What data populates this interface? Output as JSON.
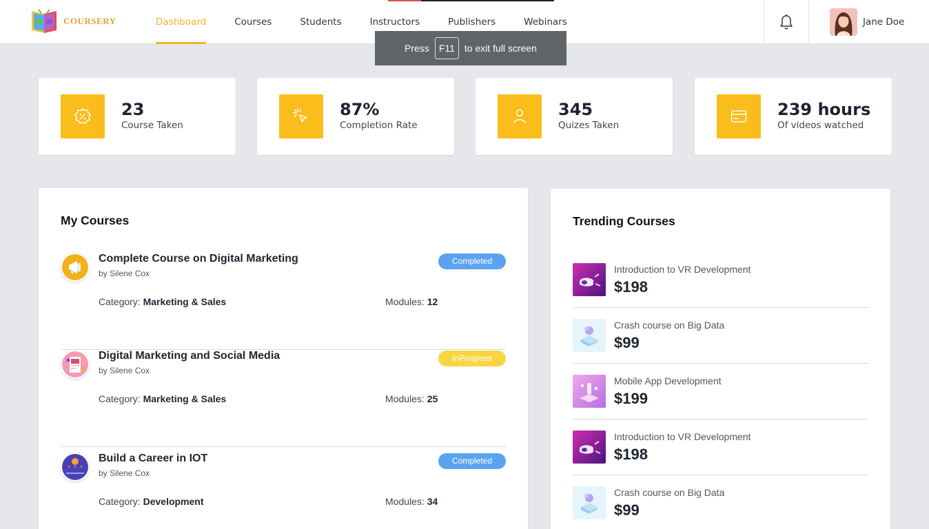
{
  "app": {
    "name": "COURSERY"
  },
  "nav": {
    "items": [
      {
        "label": "Dashboard",
        "active": true
      },
      {
        "label": "Courses",
        "active": false
      },
      {
        "label": "Students",
        "active": false
      },
      {
        "label": "Instructors",
        "active": false
      },
      {
        "label": "Publishers",
        "active": false
      },
      {
        "label": "Webinars",
        "active": false
      }
    ]
  },
  "user": {
    "name": "Jane Doe",
    "avatar_icon": "user-avatar-photo"
  },
  "toast": {
    "prefix": "Press",
    "key": "F11",
    "suffix": "to exit full screen"
  },
  "stats": [
    {
      "value": "23",
      "label": "Course Taken",
      "icon": "percent-badge-icon"
    },
    {
      "value": "87%",
      "label": "Completion Rate",
      "icon": "cursor-click-icon"
    },
    {
      "value": "345",
      "label": "Quizes Taken",
      "icon": "person-icon"
    },
    {
      "value": "239 hours",
      "label": "Of videos watched",
      "icon": "card-icon"
    }
  ],
  "my_courses": {
    "title": "My Courses",
    "category_label": "Category:",
    "modules_label": "Modules:",
    "items": [
      {
        "title": "Complete Course on Digital Marketing",
        "author": "by Silene Cox",
        "status": "Completed",
        "category": "Marketing & Sales",
        "modules": "12",
        "icon": "megaphone-icon"
      },
      {
        "title": "Digital Marketing and Social Media",
        "author": "by Silene Cox",
        "status": "InProgress",
        "category": "Marketing & Sales",
        "modules": "25",
        "icon": "social-media-icon"
      },
      {
        "title": "Build a Career in IOT",
        "author": "by Silene Cox",
        "status": "Completed",
        "category": "Development",
        "modules": "34",
        "icon": "iot-icon"
      }
    ]
  },
  "trending": {
    "title": "Trending Courses",
    "items": [
      {
        "name": "Introduction to VR Development",
        "price": "$198",
        "thumb": "vr-headset-thumbnail"
      },
      {
        "name": "Crash course on Big Data",
        "price": "$99",
        "thumb": "big-data-thumbnail"
      },
      {
        "name": "Mobile App Development",
        "price": "$199",
        "thumb": "mobile-app-thumbnail"
      },
      {
        "name": "Introduction to VR Development",
        "price": "$198",
        "thumb": "vr-headset-thumbnail"
      },
      {
        "name": "Crash course on Big Data",
        "price": "$99",
        "thumb": "big-data-thumbnail"
      }
    ]
  },
  "colors": {
    "accent": "#f3b229",
    "stat_icon_bg": "#fbbd1c",
    "completed": "#5aa3f0",
    "inprogress": "#fbd443",
    "page_bg": "#e6e7ea"
  }
}
